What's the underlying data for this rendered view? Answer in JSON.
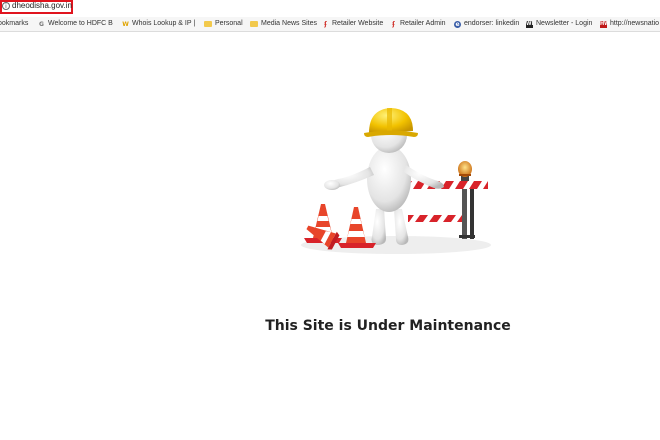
{
  "address_bar": {
    "url": "dheodisha.gov.in",
    "info_icon": "info-icon",
    "highlight_color": "#e0141e"
  },
  "bookmarks_bar": {
    "items": [
      {
        "label": "ookmarks",
        "icon": "none"
      },
      {
        "label": "Welcome to HDFC B",
        "icon": "google-g-icon",
        "glyph": "G"
      },
      {
        "label": "Whois Lookup & IP |",
        "icon": "w-logo-icon",
        "glyph": "W"
      },
      {
        "label": "Personal",
        "icon": "folder-icon",
        "glyph": ""
      },
      {
        "label": "Media News Sites",
        "icon": "folder-icon",
        "glyph": ""
      },
      {
        "label": "Retailer Website",
        "icon": "red-f-icon",
        "glyph": "ʄ"
      },
      {
        "label": "Retailer Admin",
        "icon": "red-f-icon",
        "glyph": "ʄ"
      },
      {
        "label": "endorser: linkedin",
        "icon": "e-globe-icon",
        "glyph": "e"
      },
      {
        "label": "Newsletter - Login",
        "icon": "wi-logo-icon",
        "glyph": "WI"
      },
      {
        "label": "http://newsnatio",
        "icon": "hw-logo-icon",
        "glyph": "HW"
      }
    ]
  },
  "main": {
    "illustration": "under-construction-worker-with-barrier-and-cones",
    "message": "This Site is Under Maintenance"
  },
  "colors": {
    "background": "#ffffff",
    "helmet": "#f2c200",
    "barrier_red": "#d8232a",
    "cone_orange": "#e8452a"
  }
}
